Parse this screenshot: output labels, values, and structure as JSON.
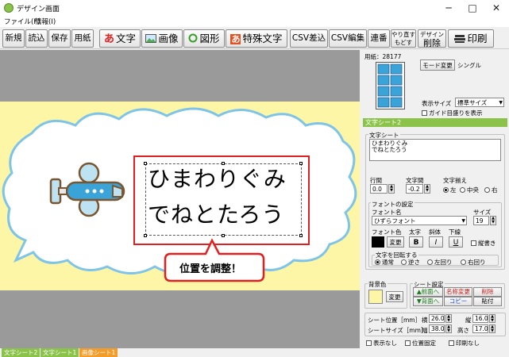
{
  "window": {
    "title": "デザイン画面",
    "minimize": "─",
    "maximize": "□",
    "close": "✕"
  },
  "menu": [
    "ファイル(F)",
    "情報(I)"
  ],
  "toolbar": {
    "new": "新規",
    "load": "読込",
    "save": "保存",
    "paper": "用紙",
    "text": "文字",
    "image": "画像",
    "shape": "図形",
    "special_text": "特殊文字",
    "csv_insert": "CSV差込",
    "csv_edit": "CSV編集",
    "serial": "連番",
    "redo": "やり直す",
    "undo": "もどす",
    "delete_top": "デザイン",
    "delete": "削除",
    "print": "印刷",
    "text_icon": "あ",
    "special_icon": "あ"
  },
  "canvas": {
    "line1": "ひまわりぐみ",
    "line2": "でねとたろう",
    "callout": "位置を調整！"
  },
  "colors": {
    "paper": "#fdf6a7",
    "canvas_bg": "#9a9a9a",
    "bubble_outline": "#7ec4e8",
    "selection": "#e02020",
    "sheet_title": "#8bc34a"
  },
  "panel": {
    "paper_label": "用紙：28177",
    "mode_button": "モード変更",
    "mode_value": "シングル",
    "display_size_label": "表示サイズ",
    "display_size_value": "標準サイズ",
    "guide_label": "ガイド目盛りを表示",
    "sheet_title": "文字シート2",
    "text_sheet_label": "文字シート",
    "text_content_1": "ひまわりぐみ",
    "text_content_2": "でねとたろう",
    "line_spacing_label": "行間",
    "line_spacing_value": "0.0",
    "char_spacing_label": "文字間",
    "char_spacing_value": "-0.2",
    "align_label": "文字揃え",
    "align_left": "左",
    "align_center": "中央",
    "align_right": "右",
    "font_settings_label": "フォントの設定",
    "font_name_label": "フォント名",
    "font_name_value": "ひずらフォント",
    "size_label": "サイズ",
    "size_value": "19",
    "font_color_label": "フォント色",
    "bold_label": "太字",
    "italic_label": "斜体",
    "underline_label": "下線",
    "change_label": "変更",
    "bold_btn": "B",
    "italic_btn": "I",
    "underline_btn": "U",
    "vertical_label": "縦書き",
    "rotate_label": "文字を回転する",
    "rot_normal": "通常",
    "rot_reverse": "逆さ",
    "rot_left": "左回り",
    "rot_right": "右回り",
    "bg_color_label": "背景色",
    "bg_change": "変更",
    "sheet_settings_label": "シート設定",
    "front_btn": "▲前面へ",
    "back_btn": "▼背面へ",
    "rename_btn": "名称変更",
    "copy_btn": "コピー",
    "delete_btn": "削除",
    "paste_btn": "貼付",
    "pos_label": "シート位置［mm］",
    "pos_x_label": "横",
    "pos_x_value": "26.0",
    "pos_y_label": "縦",
    "pos_y_value": "16.0",
    "size_label2": "シートサイズ［mm］",
    "width_label": "幅",
    "width_value": "38.0",
    "height_label": "高さ",
    "height_value": "17.0",
    "hide_label": "表示なし",
    "lock_label": "位置固定",
    "noprint_label": "印刷なし"
  },
  "status_tabs": [
    "文字シート2",
    "文字シート1",
    "画像シート1"
  ]
}
